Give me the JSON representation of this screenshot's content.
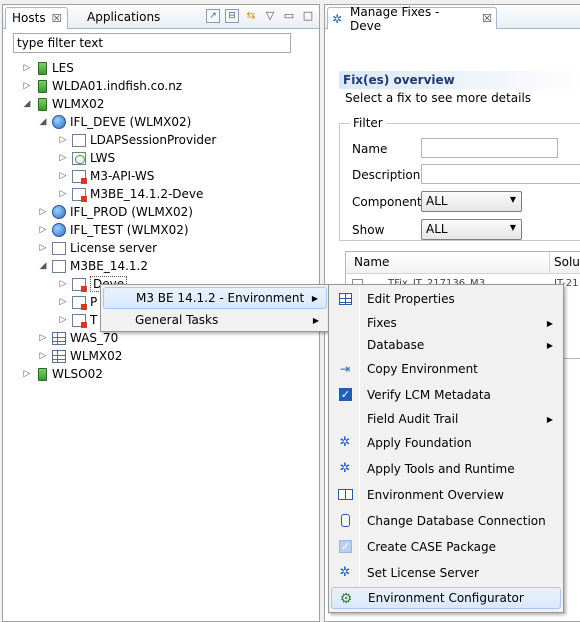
{
  "hosts_view": {
    "tabs": [
      {
        "label": "Hosts",
        "close": "☒",
        "active": true
      },
      {
        "label": "Applications",
        "active": false
      }
    ],
    "toolbar_icons": [
      "new-window-icon",
      "collapse-all-icon",
      "sync-icon",
      "view-menu-icon",
      "minimize-icon",
      "maximize-icon"
    ],
    "filter_placeholder": "type filter text",
    "tree": [
      {
        "label": "LES",
        "icon": "host-icon",
        "expander": "▷"
      },
      {
        "label": "WLDA01.indfish.co.nz",
        "icon": "host-icon",
        "expander": "▷"
      },
      {
        "label": "WLMX02",
        "icon": "host-icon",
        "expander": "◢"
      },
      {
        "label": "IFL_DEVE (WLMX02)",
        "icon": "environment-icon",
        "expander": "◢"
      },
      {
        "label": "LDAPSessionProvider",
        "icon": "component-icon",
        "expander": "▷"
      },
      {
        "label": "LWS",
        "icon": "component-green-icon",
        "expander": "▷"
      },
      {
        "label": "M3-API-WS",
        "icon": "component-red-icon",
        "expander": "▷"
      },
      {
        "label": "M3BE_14.1.2-Deve",
        "icon": "component-red-icon",
        "expander": "▷"
      },
      {
        "label": "IFL_PROD (WLMX02)",
        "icon": "environment-icon",
        "expander": "▷"
      },
      {
        "label": "IFL_TEST (WLMX02)",
        "icon": "environment-icon",
        "expander": "▷"
      },
      {
        "label": "License server",
        "icon": "component-icon",
        "expander": "▷"
      },
      {
        "label": "M3BE_14.1.2",
        "icon": "component-icon",
        "expander": "◢"
      },
      {
        "label": "Deve",
        "icon": "component-red-icon",
        "expander": "▷"
      },
      {
        "label": "P",
        "icon": "component-red-icon",
        "expander": "▷"
      },
      {
        "label": "T",
        "icon": "component-red-icon",
        "expander": "▷"
      },
      {
        "label": "WAS_70",
        "icon": "grid-icon",
        "expander": "▷"
      },
      {
        "label": "WLMX02",
        "icon": "grid-icon",
        "expander": "▷"
      },
      {
        "label": "WLSO02",
        "icon": "host-icon",
        "expander": "▷"
      }
    ]
  },
  "manage_fixes": {
    "tab_label": "Manage Fixes - Deve",
    "tab_close": "☒",
    "section_title": "Fix(es) overview",
    "section_desc": "Select a fix to see more details",
    "filter": {
      "legend": "Filter",
      "name_label": "Name",
      "description_label": "Description",
      "component_label": "Component",
      "component_value": "ALL",
      "show_label": "Show",
      "show_value": "ALL"
    },
    "table": {
      "columns": [
        "Name",
        "Soluti"
      ],
      "row_partial": "TFix_IT_217136_M3",
      "row_partial_col2": "IT-21"
    }
  },
  "context_menu": {
    "items": [
      {
        "label": "M3 BE 14.1.2 - Environment",
        "submenu": true,
        "highlighted": true
      },
      {
        "label": "General Tasks",
        "submenu": true,
        "highlighted": false
      }
    ]
  },
  "submenu": {
    "items": [
      {
        "label": "Edit Properties",
        "icon": "table-icon",
        "submenu": false
      },
      {
        "label": "Fixes",
        "icon": "",
        "submenu": true
      },
      {
        "label": "Database",
        "icon": "",
        "submenu": true
      },
      {
        "label": "Copy Environment",
        "icon": "copy-environment-icon",
        "submenu": false
      },
      {
        "label": "Verify LCM Metadata",
        "icon": "checkbox-icon",
        "submenu": false
      },
      {
        "label": "Field Audit Trail",
        "icon": "",
        "submenu": true
      },
      {
        "label": "Apply Foundation",
        "icon": "fix-icon",
        "submenu": false
      },
      {
        "label": "Apply Tools and Runtime",
        "icon": "fix-icon",
        "submenu": false
      },
      {
        "label": "Environment Overview",
        "icon": "overview-icon",
        "submenu": false
      },
      {
        "label": "Change Database Connection",
        "icon": "database-icon",
        "submenu": false
      },
      {
        "label": "Create CASE Package",
        "icon": "checkbox-disabled-icon",
        "submenu": false
      },
      {
        "label": "Set License Server",
        "icon": "fix-icon",
        "submenu": false
      },
      {
        "label": "Environment Configurator",
        "icon": "configurator-icon",
        "submenu": false,
        "highlighted": true
      }
    ]
  }
}
